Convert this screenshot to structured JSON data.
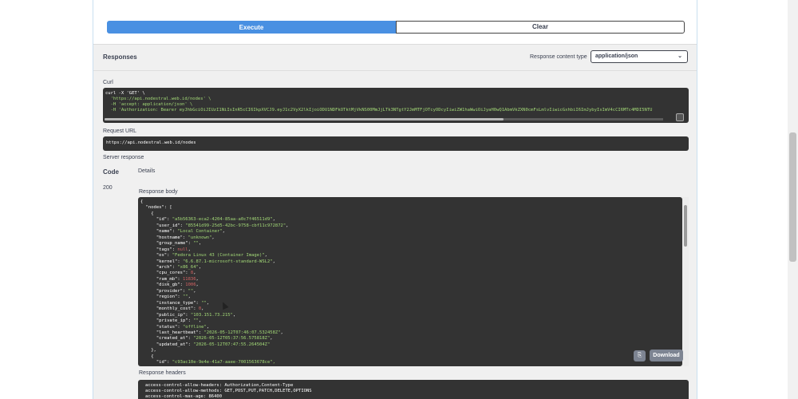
{
  "controls": {
    "execute_label": "Execute",
    "clear_label": "Clear"
  },
  "responses": {
    "heading": "Responses",
    "content_type_label": "Response content type",
    "content_type_value": "application/json"
  },
  "curl": {
    "label": "Curl",
    "line1": "curl -X 'GET' \\",
    "line2": "  'https://api.nodestral.web.id/nodes' \\",
    "line3": "  -H 'accept: application/json' \\",
    "line4_prefix": "  -H 'Authorization: Bearer ",
    "line4_token": "eyJhbGciOiJIUzI1NiIsInR5cCI6IkpXVCJ9.eyJ1c2VyX2lkIjoiODU1NDFkOTktMjVkNS00MmJjLTk3NTgtY2JmMTFjOTcyODcyIiwiZW1haWwiOiJyaH0wQ1AbmVkZXN0cmFsLmlvIiwicGxhbiI6ImJybyIsImV4cCI6MTc4MDI5NTU"
  },
  "request_url": {
    "label": "Request URL",
    "value": "https://api.nodestral.web.id/nodes"
  },
  "server_response": {
    "label": "Server response",
    "code_header": "Code",
    "details_header": "Details",
    "code": "200",
    "body_label": "Response body",
    "download_label": "Download",
    "headers_label": "Response headers"
  },
  "response_body": {
    "open": "{",
    "nodes_key": "  \"nodes\": [",
    "obj_open": "    {",
    "fields": [
      {
        "key": "id",
        "value": "\"a5b56363-eca2-4204-85aa-a0c7f46511d9\"",
        "type": "s"
      },
      {
        "key": "user_id",
        "value": "\"85541d99-25d5-42bc-9758-cbf11c972872\"",
        "type": "s"
      },
      {
        "key": "name",
        "value": "\"Local Container\"",
        "type": "s"
      },
      {
        "key": "hostname",
        "value": "\"unknown\"",
        "type": "s"
      },
      {
        "key": "group_name",
        "value": "\"\"",
        "type": "s"
      },
      {
        "key": "tags",
        "value": "null",
        "type": "n"
      },
      {
        "key": "os",
        "value": "\"Fedora Linux 43 (Container Image)\"",
        "type": "s"
      },
      {
        "key": "kernel",
        "value": "\"6.6.87.1-microsoft-standard-WSL2\"",
        "type": "s"
      },
      {
        "key": "arch",
        "value": "\"x86_64\"",
        "type": "s"
      },
      {
        "key": "cpu_cores",
        "value": "8",
        "type": "n"
      },
      {
        "key": "ram_mb",
        "value": "11836",
        "type": "n"
      },
      {
        "key": "disk_gb",
        "value": "1006",
        "type": "n"
      },
      {
        "key": "provider",
        "value": "\"\"",
        "type": "s"
      },
      {
        "key": "region",
        "value": "\"\"",
        "type": "s"
      },
      {
        "key": "instance_type",
        "value": "\"\"",
        "type": "s"
      },
      {
        "key": "monthly_cost",
        "value": "0",
        "type": "n"
      },
      {
        "key": "public_ip",
        "value": "\"103.151.73.215\"",
        "type": "s"
      },
      {
        "key": "private_ip",
        "value": "\"\"",
        "type": "s"
      },
      {
        "key": "status",
        "value": "\"offline\"",
        "type": "s"
      },
      {
        "key": "last_heartbeat",
        "value": "\"2026-05-12T07:46:07.532458Z\"",
        "type": "s"
      },
      {
        "key": "created_at",
        "value": "\"2026-05-12T05:37:56.575818Z\"",
        "type": "s"
      },
      {
        "key": "updated_at",
        "value": "\"2026-05-12T07:47:55.264504Z\"",
        "type": "s"
      }
    ],
    "obj_close": "    },",
    "obj2_open": "    {",
    "obj2_first_key": "id",
    "obj2_first_value": "\"c93ac10e-9e4e-41a7-aaee-7001563678ce\","
  },
  "response_headers": [
    "access-control-allow-headers: Authorization,Content-Type",
    "access-control-allow-methods: GET,POST,PUT,PATCH,DELETE,OPTIONS",
    "access-control-max-age: 86400"
  ]
}
